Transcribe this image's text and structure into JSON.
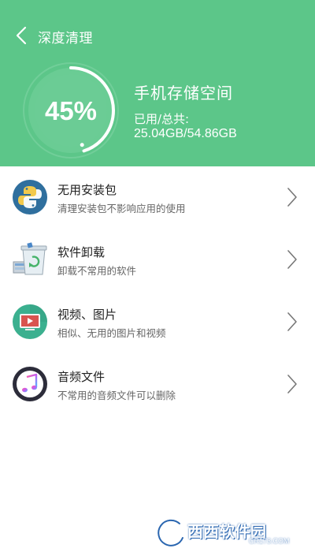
{
  "header": {
    "title": "深度清理",
    "back_icon": "chevron-left-icon",
    "background_color": "#5cc689"
  },
  "storage": {
    "percent_text": "45%",
    "percent_value": 0.45,
    "title": "手机存储空间",
    "label": "已用/总共:",
    "values": "25.04GB/54.86GB"
  },
  "items": [
    {
      "title": "无用安装包",
      "subtitle": "清理安装包不影响应用的使用",
      "icon": "python-package-icon"
    },
    {
      "title": "软件卸载",
      "subtitle": "卸载不常用的软件",
      "icon": "recycle-bin-icon"
    },
    {
      "title": "视频、图片",
      "subtitle": "相似、无用的图片和视频",
      "icon": "video-player-icon"
    },
    {
      "title": "音频文件",
      "subtitle": "不常用的音频文件可以删除",
      "icon": "music-note-icon"
    }
  ],
  "watermark": {
    "text": "西西软件园",
    "url": "CR173.COM"
  }
}
